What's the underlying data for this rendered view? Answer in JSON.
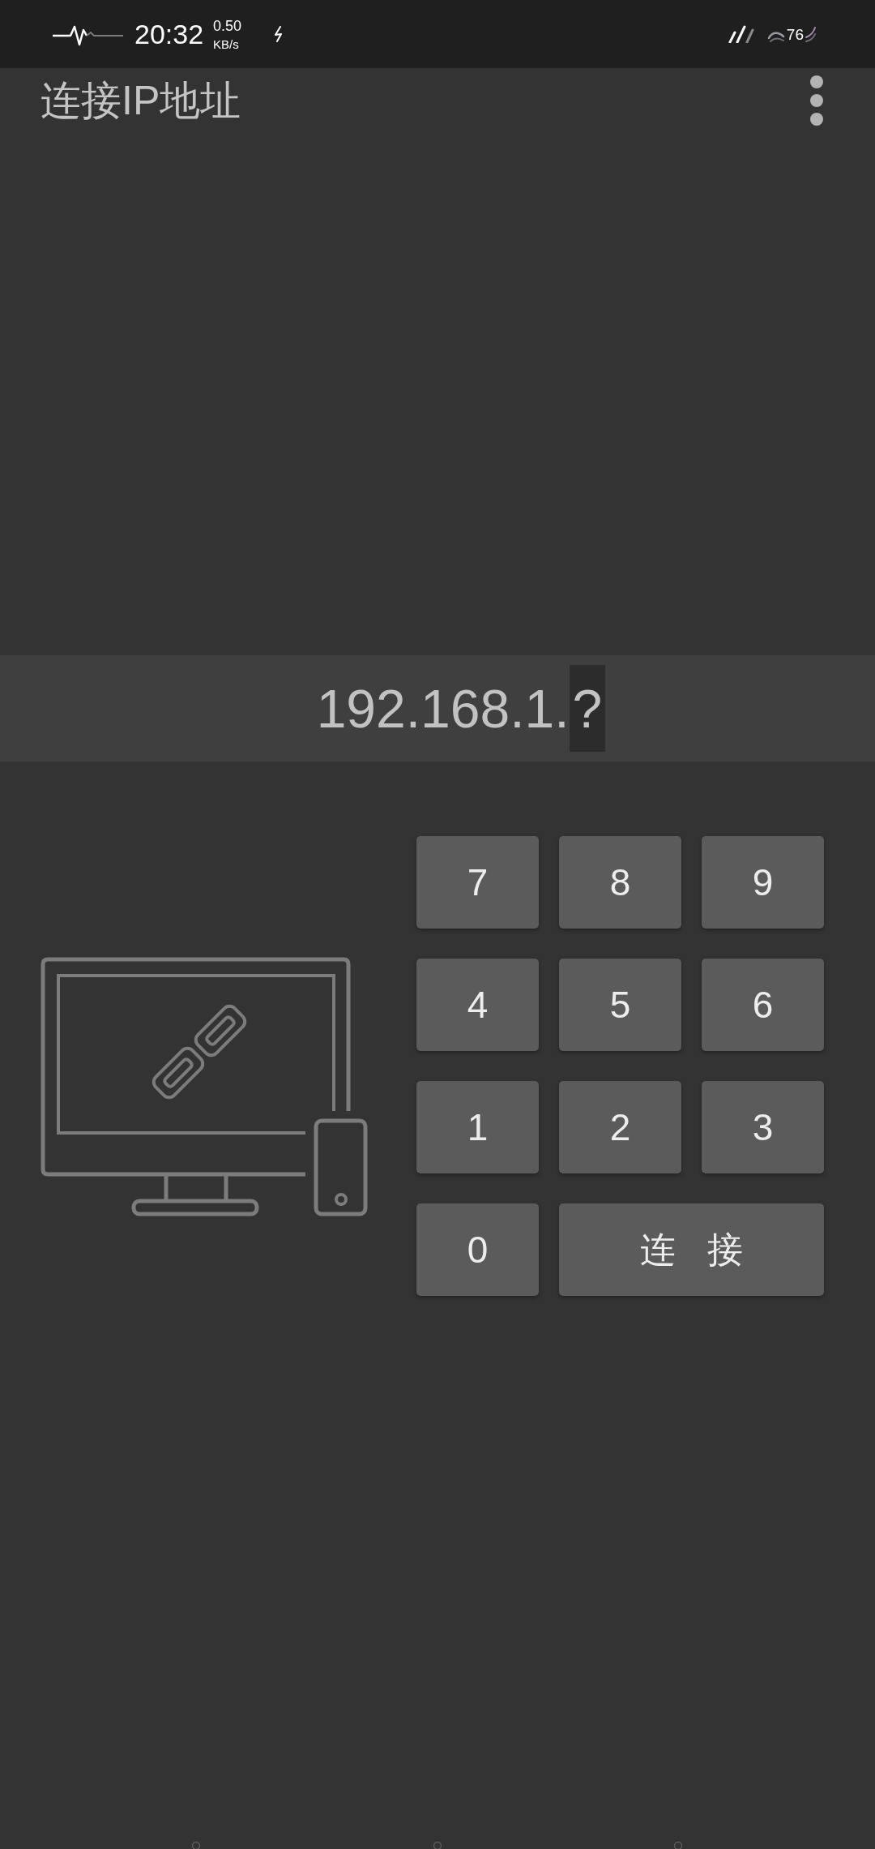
{
  "status_bar": {
    "time": "20:32",
    "speed_value": "0.50",
    "speed_unit": "KB/s",
    "battery": "76"
  },
  "app_bar": {
    "title": "连接IP地址"
  },
  "ip_field": {
    "value": "192.168.1.",
    "pending": "?"
  },
  "keypad": {
    "keys": [
      {
        "label": "7",
        "kind": "digit"
      },
      {
        "label": "8",
        "kind": "digit"
      },
      {
        "label": "9",
        "kind": "digit"
      },
      {
        "label": "4",
        "kind": "digit"
      },
      {
        "label": "5",
        "kind": "digit"
      },
      {
        "label": "6",
        "kind": "digit"
      },
      {
        "label": "1",
        "kind": "digit"
      },
      {
        "label": "2",
        "kind": "digit"
      },
      {
        "label": "3",
        "kind": "digit"
      },
      {
        "label": "0",
        "kind": "digit"
      },
      {
        "label": "连 接",
        "kind": "action"
      }
    ]
  }
}
